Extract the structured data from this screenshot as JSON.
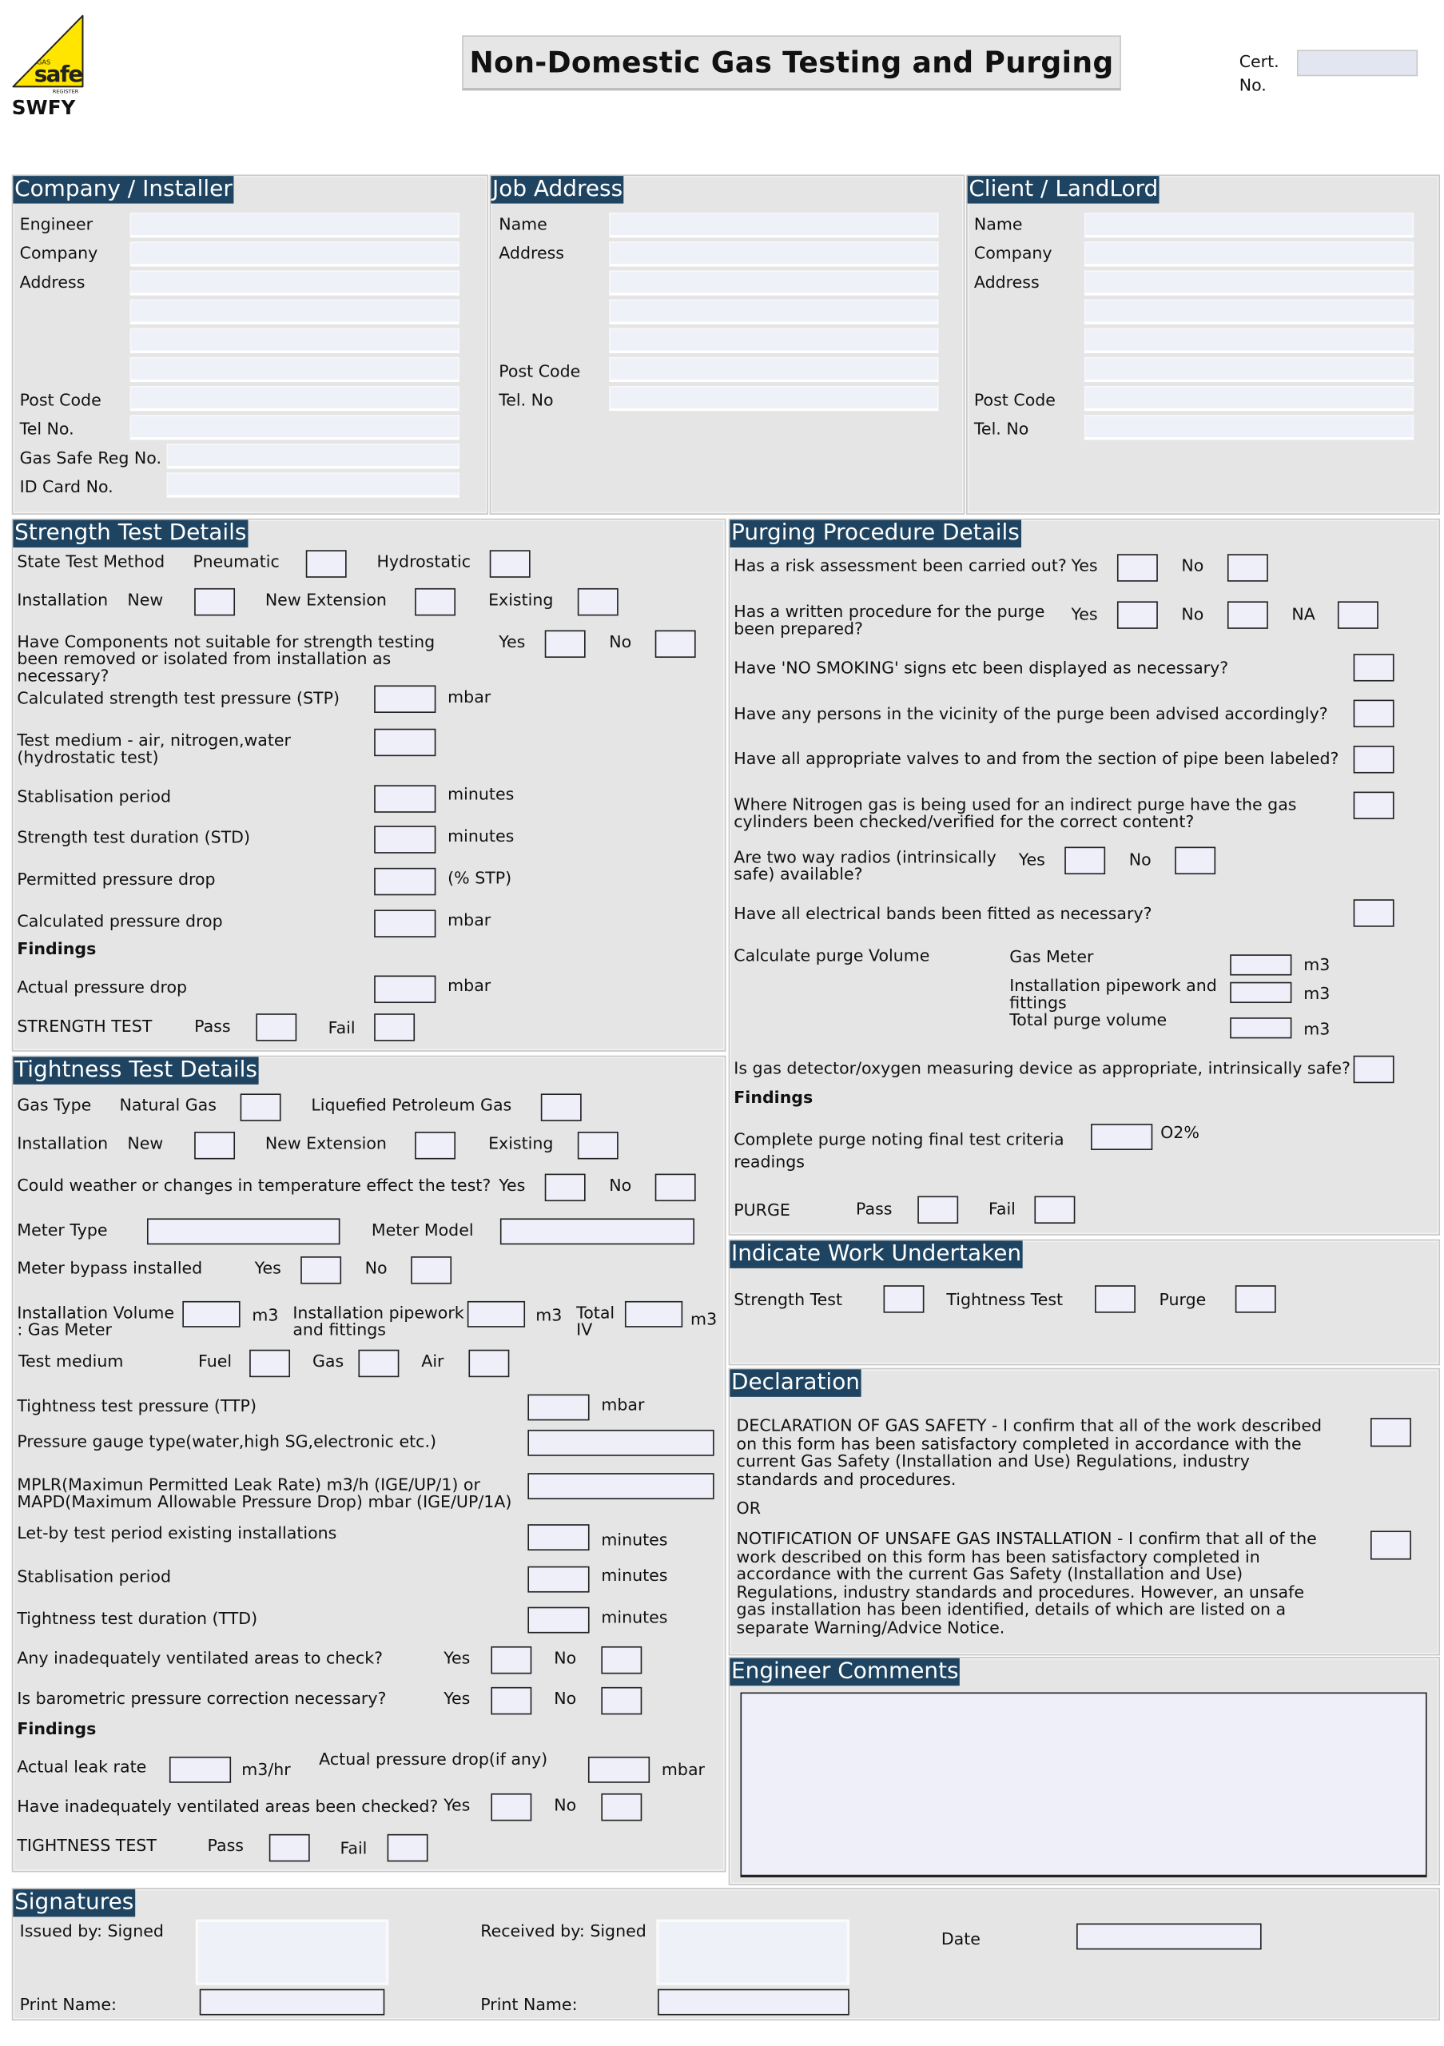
{
  "header": {
    "logo": {
      "icon": "gas-safe-register-logo",
      "brand_top": "GAS",
      "brand_main": "safe",
      "brand_sub": "REGISTER",
      "company": "SWFY",
      "color": "#ffe500"
    },
    "title": "Non-Domestic Gas Testing and Purging",
    "cert_label_1": "Cert.",
    "cert_label_2": "No.",
    "cert_value": ""
  },
  "colors": {
    "section_title_bg": "#1e4461",
    "panel_bg": "#e5e5e5",
    "field_bg": "#eff1f9"
  },
  "company_installer": {
    "title": "Company / Installer",
    "engineer": "Engineer",
    "company": "Company",
    "address": "Address",
    "post_code": "Post Code",
    "tel": "Tel No.",
    "gas_safe_reg": "Gas Safe Reg No.",
    "id_card": "ID Card No."
  },
  "job_address": {
    "title": "Job Address",
    "name": "Name",
    "address": "Address",
    "post_code": "Post Code",
    "tel": "Tel. No"
  },
  "client": {
    "title": "Client / LandLord",
    "name": "Name",
    "company": "Company",
    "address": "Address",
    "post_code": "Post Code",
    "tel": "Tel. No"
  },
  "strength": {
    "title": "Strength Test Details",
    "state_test_method": "State Test Method",
    "pneumatic": "Pneumatic",
    "hydrostatic": "Hydrostatic",
    "installation": "Installation",
    "new": "New",
    "new_extension": "New Extension",
    "existing": "Existing",
    "components_q": "Have Components not suitable for strength testing been removed or isolated from installation as necessary?",
    "yes": "Yes",
    "no": "No",
    "stp": "Calculated strength test pressure (STP)",
    "stp_unit": "mbar",
    "medium": "Test medium - air, nitrogen,water (hydrostatic test)",
    "stab": "Stablisation period",
    "stab_unit": "minutes",
    "std": "Strength test duration (STD)",
    "std_unit": "minutes",
    "permitted": "Permitted pressure drop",
    "permitted_unit": "(% STP)",
    "calc_drop": "Calculated pressure drop",
    "calc_drop_unit": "mbar",
    "findings": "Findings",
    "actual_drop": "Actual pressure drop",
    "actual_drop_unit": "mbar",
    "result_label": "STRENGTH TEST",
    "pass": "Pass",
    "fail": "Fail"
  },
  "tightness": {
    "title": "Tightness Test Details",
    "gas_type": "Gas Type",
    "natural_gas": "Natural Gas",
    "lpg": "Liquefied Petroleum Gas",
    "installation": "Installation",
    "new": "New",
    "new_extension": "New Extension",
    "existing": "Existing",
    "weather_q": "Could weather or changes in temperature effect the test?",
    "yes": "Yes",
    "no": "No",
    "meter_type": "Meter Type",
    "meter_model": "Meter Model",
    "bypass": "Meter bypass installed",
    "iv_gas_meter": "Installation Volume : Gas Meter",
    "m3": "m3",
    "iv_pipework": "Installation pipework and fittings",
    "total_iv": "Total IV",
    "test_medium": "Test medium",
    "fuel": "Fuel",
    "gas": "Gas",
    "air": "Air",
    "ttp": "Tightness test pressure (TTP)",
    "mbar": "mbar",
    "gauge": "Pressure gauge type(water,high SG,electronic etc.)",
    "mplr": "MPLR(Maximun Permitted Leak Rate) m3/h (IGE/UP/1) or MAPD(Maximum Allowable Pressure Drop) mbar (IGE/UP/1A)",
    "letby": "Let-by test period existing installations",
    "minutes": "minutes",
    "stab": "Stablisation period",
    "ttd": "Tightness test duration (TTD)",
    "vent_q": "Any inadequately ventilated areas to check?",
    "baro_q": "Is barometric pressure correction necessary?",
    "findings": "Findings",
    "leak_rate": "Actual leak rate",
    "leak_unit": "m3/hr",
    "actual_drop": "Actual pressure drop(if any)",
    "vent_checked_q": "Have inadequately ventilated areas been checked?",
    "result_label": "TIGHTNESS TEST",
    "pass": "Pass",
    "fail": "Fail"
  },
  "purging": {
    "title": "Purging Procedure Details",
    "risk_q": "Has a risk assessment been carried out?",
    "written_q": "Has a written procedure for the purge been prepared?",
    "yes": "Yes",
    "no": "No",
    "na": "NA",
    "smoking_q": "Have 'NO SMOKING' signs etc been displayed as necessary?",
    "persons_q": "Have any persons in the vicinity of the purge been advised accordingly?",
    "valves_q": "Have all appropriate valves to and from the section of pipe been labeled?",
    "nitrogen_q": "Where Nitrogen gas is being used for an indirect purge have the gas cylinders been checked/verified for the correct content?",
    "radios_q": "Are two way radios (intrinsically safe) available?",
    "bands_q": "Have all electrical bands been fitted as necessary?",
    "calc_volume": "Calculate purge Volume",
    "gas_meter": "Gas Meter",
    "pipework": "Installation pipework and fittings",
    "total": "Total purge volume",
    "m3": "m3",
    "detector_q": "Is gas detector/oxygen measuring device as appropriate, intrinsically safe?",
    "findings": "Findings",
    "complete_purge": "Complete purge noting final test criteria readings",
    "o2": "O2%",
    "result_label": "PURGE",
    "pass": "Pass",
    "fail": "Fail"
  },
  "work": {
    "title": "Indicate Work Undertaken",
    "strength": "Strength Test",
    "tightness": "Tightness Test",
    "purge": "Purge"
  },
  "declaration": {
    "title": "Declaration",
    "safe_text": "DECLARATION OF GAS SAFETY - I confirm that all of the work described on this form has been satisfactory completed in accordance with the current Gas Safety (Installation and Use) Regulations, industry standards and procedures.",
    "or": "OR",
    "unsafe_text": "NOTIFICATION OF UNSAFE GAS INSTALLATION - I confirm that all of the work described on this form has been satisfactory completed in accordance with the current Gas Safety (Installation and Use) Regulations, industry standards and procedures. However, an unsafe gas installation has been identified, details of which are listed on a separate Warning/Advice Notice."
  },
  "comments": {
    "title": "Engineer Comments",
    "value": ""
  },
  "signatures": {
    "title": "Signatures",
    "issued_by": "Issued by: Signed",
    "received_by": "Received by: Signed",
    "date": "Date",
    "print_name": "Print Name:"
  }
}
